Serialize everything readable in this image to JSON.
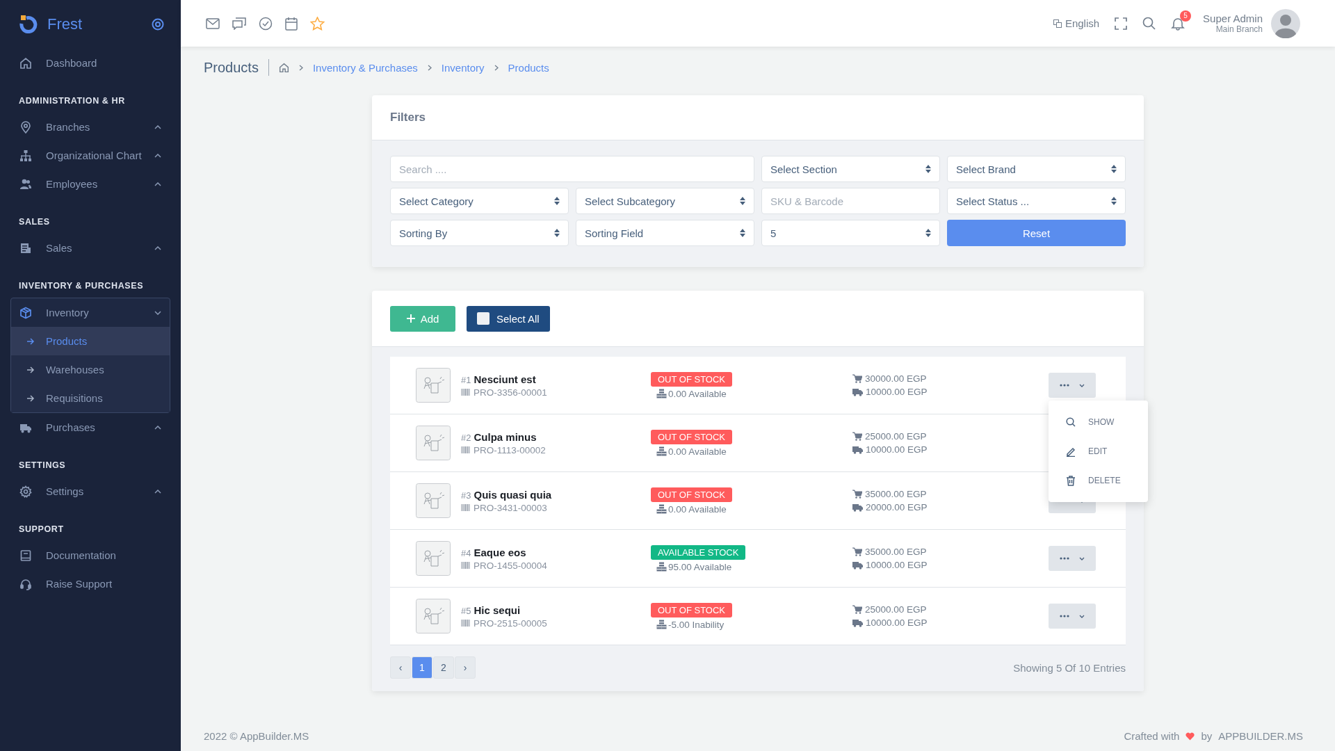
{
  "sidebar": {
    "brand": "Frest",
    "sections": [
      {
        "items": [
          {
            "label": "Dashboard",
            "kind": "link",
            "selected": false
          }
        ]
      },
      {
        "title": "ADMINISTRATION & HR",
        "items": [
          {
            "label": "Branches",
            "kind": "group",
            "expanded": false,
            "selected": false
          },
          {
            "label": "Organizational Chart",
            "kind": "group",
            "expanded": false,
            "selected": false
          },
          {
            "label": "Employees",
            "kind": "group",
            "expanded": false,
            "selected": false
          }
        ]
      },
      {
        "title": "SALES",
        "items": [
          {
            "label": "Sales",
            "kind": "group",
            "expanded": false,
            "selected": false
          }
        ]
      },
      {
        "title": "INVENTORY & PURCHASES",
        "items": [
          {
            "label": "Inventory",
            "kind": "group",
            "expanded": true,
            "selected": false,
            "children": [
              {
                "label": "Products",
                "selected": true
              },
              {
                "label": "Warehouses",
                "selected": false
              },
              {
                "label": "Requisitions",
                "selected": false
              }
            ]
          },
          {
            "label": "Purchases",
            "kind": "group",
            "expanded": false,
            "selected": false
          }
        ]
      },
      {
        "title": "SETTINGS",
        "items": [
          {
            "label": "Settings",
            "kind": "group",
            "expanded": false,
            "selected": false
          }
        ]
      },
      {
        "title": "SUPPORT",
        "items": [
          {
            "label": "Documentation",
            "kind": "link",
            "selected": false
          },
          {
            "label": "Raise Support",
            "kind": "link",
            "selected": false
          }
        ]
      }
    ]
  },
  "topbar": {
    "language": "English",
    "notifications": "5",
    "user": {
      "name": "Super Admin",
      "branch": "Main Branch"
    }
  },
  "breadcrumb": {
    "title": "Products",
    "links": [
      "Inventory & Purchases",
      "Inventory",
      "Products"
    ]
  },
  "filters": {
    "title": "Filters",
    "fields": [
      {
        "kind": "search",
        "placeholder": "Search ...."
      },
      {
        "kind": "select",
        "value": "Select Section"
      },
      {
        "kind": "select",
        "value": "Select Brand"
      },
      {
        "kind": "select",
        "value": "Select Category"
      },
      {
        "kind": "select",
        "value": "Select Subcategory"
      },
      {
        "kind": "input",
        "placeholder": "SKU & Barcode"
      },
      {
        "kind": "select",
        "value": "Select Status ..."
      },
      {
        "kind": "select",
        "value": "Sorting By"
      },
      {
        "kind": "select",
        "value": "Sorting Field"
      },
      {
        "kind": "select",
        "value": "5"
      },
      {
        "kind": "button",
        "label": "Reset"
      }
    ]
  },
  "products": {
    "add": "Add",
    "select_all": {
      "label": "Select All",
      "checked": false
    },
    "rows": [
      {
        "number": "#1",
        "name": "Nesciunt est",
        "sku": "PRO-3356-00001",
        "status": {
          "label": "OUT OF STOCK",
          "kind": "out"
        },
        "stock": "0.00 Available",
        "price": "30000.00 EGP",
        "cost": "10000.00 EGP",
        "menu_open": true
      },
      {
        "number": "#2",
        "name": "Culpa minus",
        "sku": "PRO-1113-00002",
        "status": {
          "label": "OUT OF STOCK",
          "kind": "out"
        },
        "stock": "0.00 Available",
        "price": "25000.00 EGP",
        "cost": "10000.00 EGP",
        "menu_open": false
      },
      {
        "number": "#3",
        "name": "Quis quasi quia",
        "sku": "PRO-3431-00003",
        "status": {
          "label": "OUT OF STOCK",
          "kind": "out"
        },
        "stock": "0.00 Available",
        "price": "35000.00 EGP",
        "cost": "20000.00 EGP",
        "menu_open": false
      },
      {
        "number": "#4",
        "name": "Eaque eos",
        "sku": "PRO-1455-00004",
        "status": {
          "label": "AVAILABLE STOCK",
          "kind": "available"
        },
        "stock": "95.00 Available",
        "price": "35000.00 EGP",
        "cost": "10000.00 EGP",
        "menu_open": false
      },
      {
        "number": "#5",
        "name": "Hic sequi",
        "sku": "PRO-2515-00005",
        "status": {
          "label": "OUT OF STOCK",
          "kind": "out"
        },
        "stock": "-5.00 Inability",
        "price": "25000.00 EGP",
        "cost": "10000.00 EGP",
        "menu_open": false
      }
    ],
    "menu": [
      "SHOW",
      "EDIT",
      "DELETE"
    ],
    "pagination": {
      "prev": "‹",
      "pages": [
        {
          "label": "1",
          "selected": true
        },
        {
          "label": "2",
          "selected": false
        }
      ],
      "next": "›"
    },
    "summary": "Showing 5 Of 10 Entries"
  },
  "footer": {
    "copyright": "2022 © AppBuilder.MS",
    "crafted": "Crafted with",
    "by": "by",
    "brand": "APPBUILDER.MS"
  }
}
